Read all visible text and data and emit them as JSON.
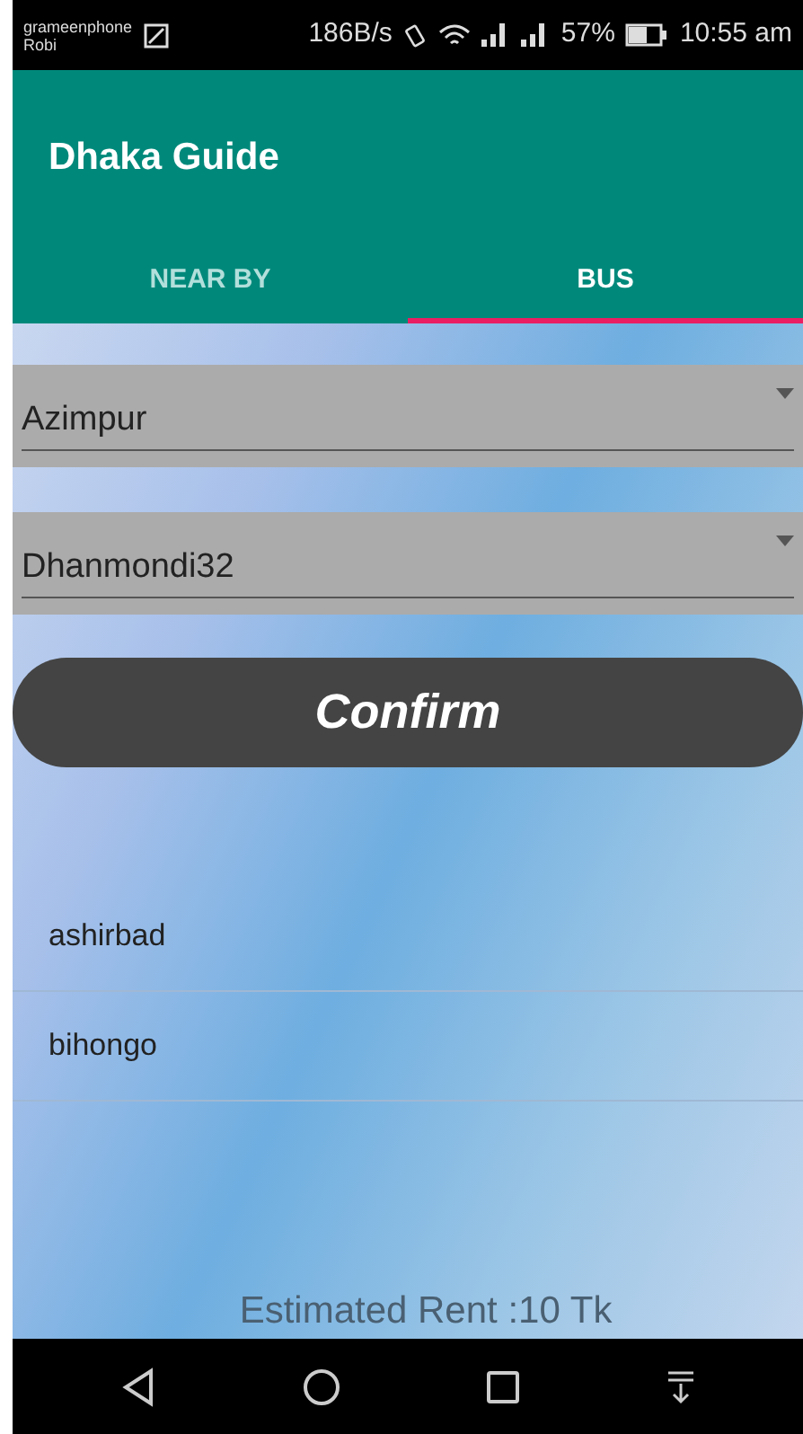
{
  "status_bar": {
    "carriers": [
      "grameenphone",
      "Robi"
    ],
    "net_speed": "186B/s",
    "battery": "57%",
    "time": "10:55 am"
  },
  "app_bar": {
    "title": "Dhaka Guide"
  },
  "tabs": [
    {
      "label": "NEAR BY",
      "selected": false
    },
    {
      "label": "BUS",
      "selected": true
    }
  ],
  "dropdowns": [
    {
      "value": "Azimpur"
    },
    {
      "value": "Dhanmondi32"
    }
  ],
  "confirm_button": {
    "label": "Confirm"
  },
  "results": [
    {
      "name": "ashirbad"
    },
    {
      "name": "bihongo"
    }
  ],
  "estimated_rent": "Estimated Rent :10 Tk"
}
